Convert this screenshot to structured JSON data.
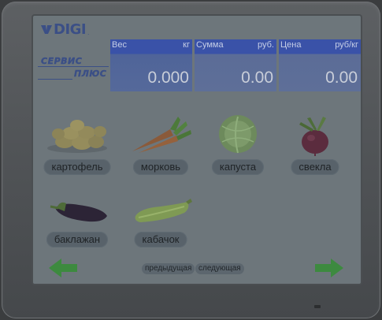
{
  "brand": {
    "name": "DIGI",
    "mark": "."
  },
  "service_logo": {
    "line1": "СЕРВИС",
    "line2": "ПЛЮС"
  },
  "readings": [
    {
      "label": "Вес",
      "unit": "кг",
      "value": "0.000"
    },
    {
      "label": "Сумма",
      "unit": "руб.",
      "value": "0.00"
    },
    {
      "label": "Цена",
      "unit": "руб/кг",
      "value": "0.00"
    }
  ],
  "products": [
    {
      "label": "картофель",
      "icon": "potato-icon"
    },
    {
      "label": "морковь",
      "icon": "carrot-icon"
    },
    {
      "label": "капуста",
      "icon": "cabbage-icon"
    },
    {
      "label": "свекла",
      "icon": "beet-icon"
    },
    {
      "label": "баклажан",
      "icon": "eggplant-icon"
    },
    {
      "label": "кабачок",
      "icon": "zucchini-icon"
    }
  ],
  "pagination": {
    "prev_label": "предыдущая",
    "next_label": "следующая"
  },
  "colors": {
    "accent": "#3a52a8",
    "arrow": "#3d8a3f",
    "screen": "#6d767b"
  }
}
